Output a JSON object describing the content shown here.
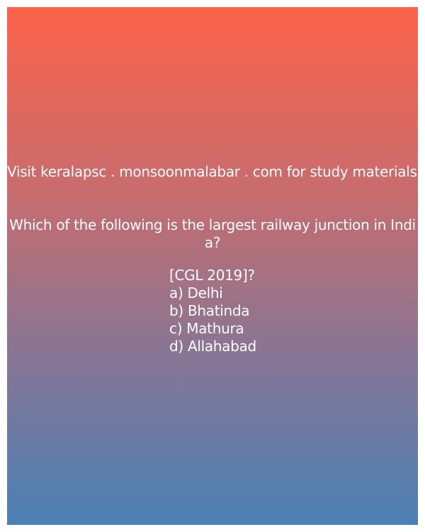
{
  "promo_text": "Visit keralapsc . monsoonmalabar . com for study materials",
  "question": "Which of the following is the largest railway junction in India?",
  "exam_tag": "[CGL 2019]?",
  "options": [
    "a) Delhi",
    "b) Bhatinda",
    "c) Mathura",
    "d) Allahabad"
  ],
  "colors": {
    "gradient_top": "#fc634b",
    "gradient_bottom": "#4a80b4",
    "text": "#ffffff"
  }
}
